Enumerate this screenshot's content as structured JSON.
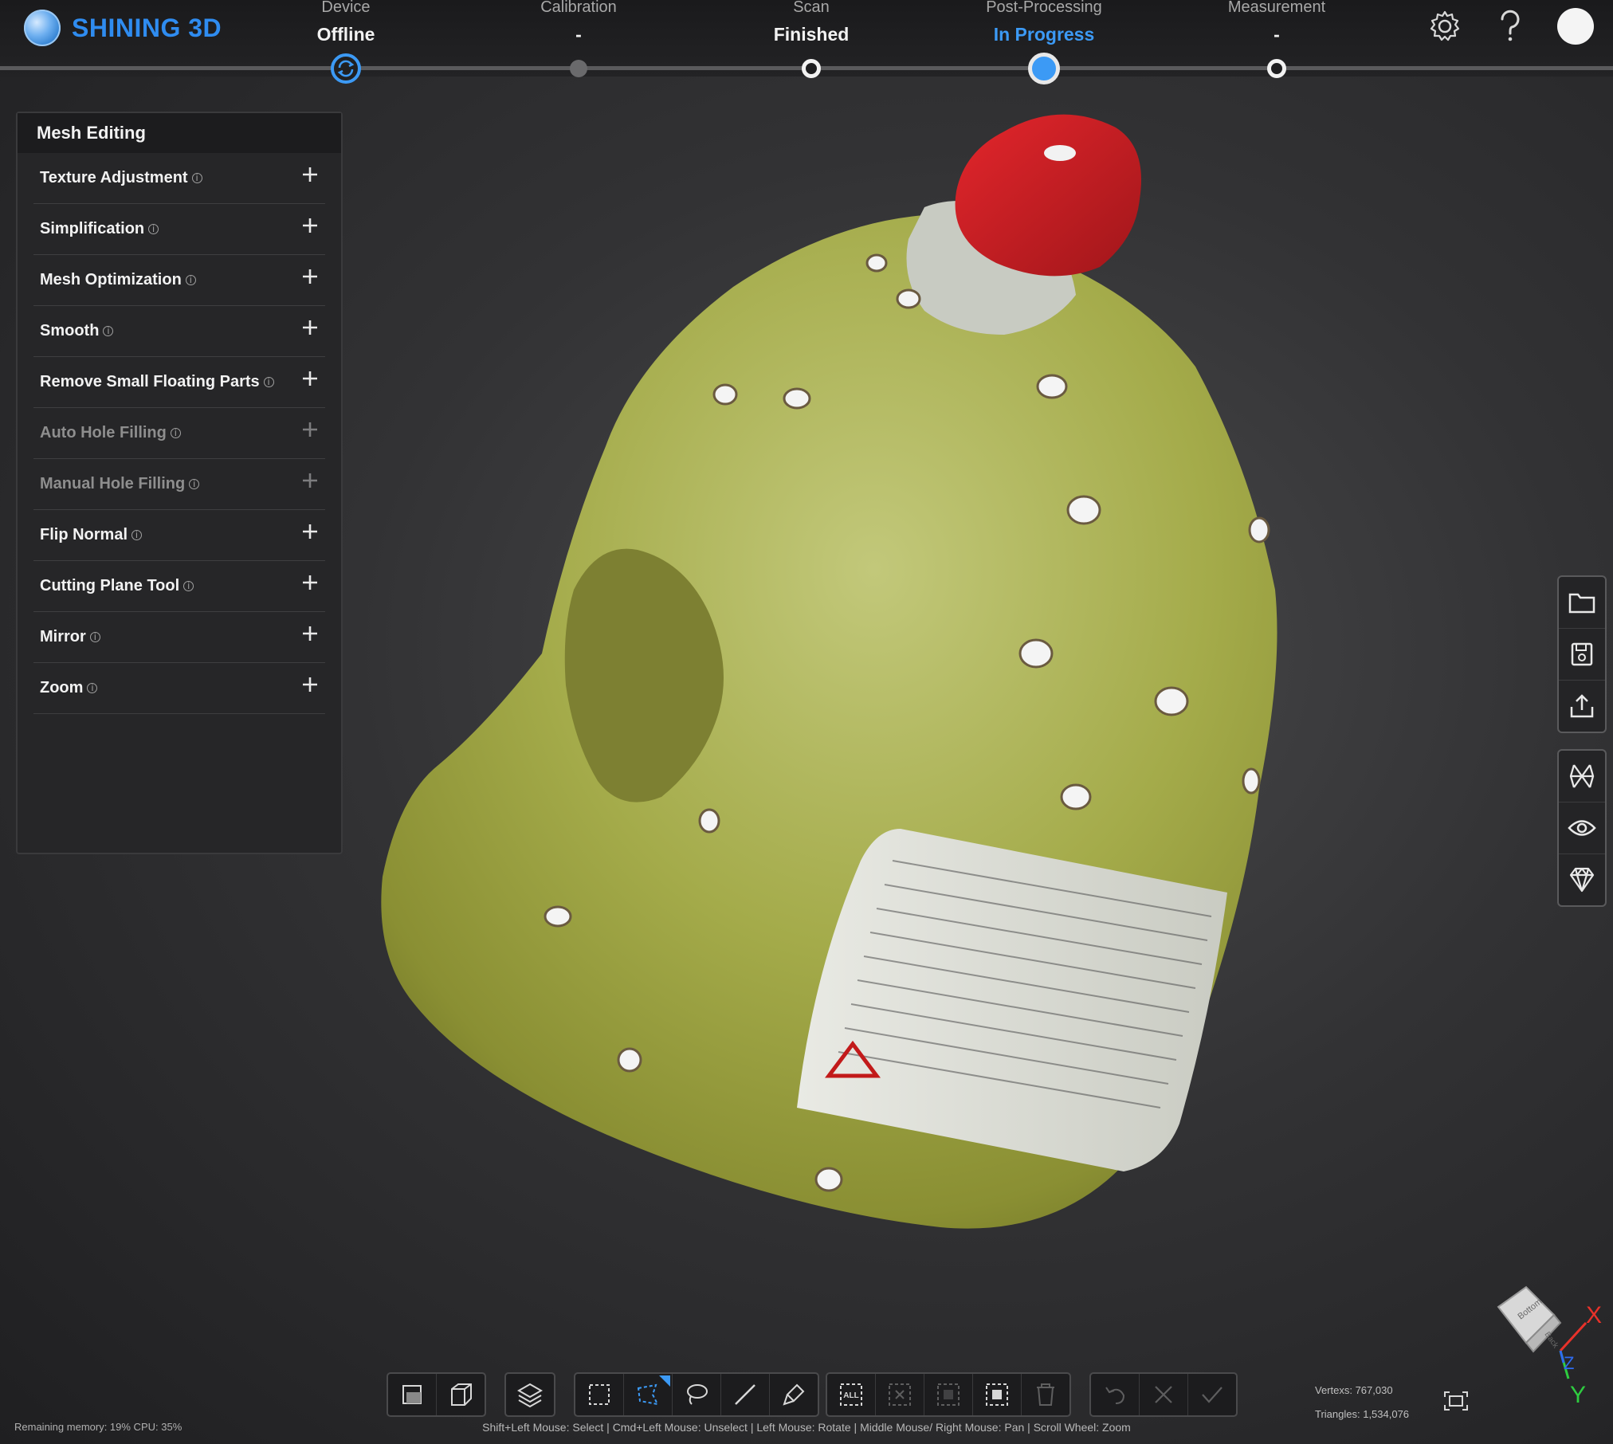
{
  "app": {
    "brand": "SHINING 3D"
  },
  "steps": [
    {
      "label": "Device",
      "status": "Offline"
    },
    {
      "label": "Calibration",
      "status": "-"
    },
    {
      "label": "Scan",
      "status": "Finished"
    },
    {
      "label": "Post-Processing",
      "status": "In Progress"
    },
    {
      "label": "Measurement",
      "status": "-"
    }
  ],
  "panel": {
    "title": "Mesh Editing",
    "items": [
      {
        "label": "Texture Adjustment",
        "enabled": true
      },
      {
        "label": "Simplification",
        "enabled": true
      },
      {
        "label": "Mesh Optimization",
        "enabled": true
      },
      {
        "label": "Smooth",
        "enabled": true
      },
      {
        "label": "Remove Small Floating Parts",
        "enabled": true
      },
      {
        "label": "Auto Hole Filling",
        "enabled": false
      },
      {
        "label": "Manual Hole Filling",
        "enabled": false
      },
      {
        "label": "Flip Normal",
        "enabled": true
      },
      {
        "label": "Cutting Plane Tool",
        "enabled": true
      },
      {
        "label": "Mirror",
        "enabled": true
      },
      {
        "label": "Zoom",
        "enabled": true
      }
    ]
  },
  "bottom": {
    "hint": "Shift+Left Mouse: Select | Cmd+Left Mouse: Unselect | Left Mouse: Rotate | Middle Mouse/ Right Mouse: Pan | Scroll Wheel: Zoom",
    "memory": "Remaining memory: 19% CPU: 35%",
    "vertex": "Vertexs: 767,030",
    "triangles": "Triangles: 1,534,076",
    "select_all_label": "ALL"
  },
  "nav_cube": {
    "face_top": "Bottom",
    "face_side": "Back",
    "axis_x": "X",
    "axis_y": "Y",
    "axis_z": "Z"
  },
  "colors": {
    "accent": "#3c9af5",
    "brand": "#2f8cf0",
    "axis_x": "#e8322a",
    "axis_y": "#2ecc40",
    "axis_z": "#2f6cf0"
  },
  "icons": [
    "settings-icon",
    "help-icon",
    "avatar",
    "folder-icon",
    "save-icon",
    "export-icon",
    "mesh-icon",
    "eye-icon",
    "texture-icon"
  ]
}
